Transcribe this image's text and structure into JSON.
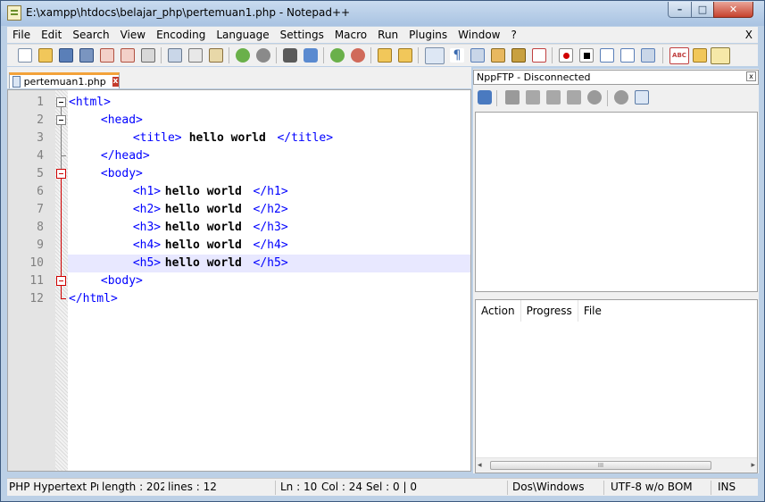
{
  "window": {
    "title": "E:\\xampp\\htdocs\\belajar_php\\pertemuan1.php - Notepad++",
    "min_glyph": "–",
    "max_glyph": "□",
    "close_glyph": "✕"
  },
  "menu": [
    "File",
    "Edit",
    "Search",
    "View",
    "Encoding",
    "Language",
    "Settings",
    "Macro",
    "Run",
    "Plugins",
    "Window",
    "?"
  ],
  "menu_close": "X",
  "toolbar_icons": [
    "new-file-icon",
    "open-file-icon",
    "save-icon",
    "save-all-icon",
    "close-icon",
    "close-all-icon",
    "print-icon",
    "cut-icon",
    "copy-icon",
    "paste-icon",
    "undo-icon",
    "redo-icon",
    "find-icon",
    "replace-icon",
    "zoom-in-icon",
    "zoom-out-icon",
    "sync-vertical-icon",
    "sync-horizontal-icon",
    "word-wrap-icon",
    "show-all-chars-icon",
    "indent-guide-icon",
    "user-language-icon",
    "doc-map-icon",
    "function-list-icon",
    "record-macro-icon",
    "stop-record-icon",
    "play-macro-icon",
    "play-multiple-icon",
    "save-macro-icon",
    "spell-check-icon",
    "folder-workspace-icon",
    "nppftp-toggle-icon"
  ],
  "tab": {
    "label": "pertemuan1.php",
    "close_glyph": "x"
  },
  "editor": {
    "current_line": 10,
    "lines": [
      {
        "num": "1",
        "indent": 0,
        "tag1": "<html>",
        "text": "",
        "tag2": ""
      },
      {
        "num": "2",
        "indent": 1,
        "tag1": "<head>",
        "text": "",
        "tag2": ""
      },
      {
        "num": "3",
        "indent": 2,
        "tag1": "<title>",
        "text": "hello world",
        "tag2": "</title>"
      },
      {
        "num": "4",
        "indent": 1,
        "tag1": "</head>",
        "text": "",
        "tag2": ""
      },
      {
        "num": "5",
        "indent": 1,
        "tag1": "<body>",
        "text": "",
        "tag2": ""
      },
      {
        "num": "6",
        "indent": 2,
        "tag1": "<h1>",
        "text": "hello world",
        "tag2": "</h1>"
      },
      {
        "num": "7",
        "indent": 2,
        "tag1": "<h2>",
        "text": "hello world",
        "tag2": "</h2>"
      },
      {
        "num": "8",
        "indent": 2,
        "tag1": "<h3>",
        "text": "hello world",
        "tag2": "</h3>"
      },
      {
        "num": "9",
        "indent": 2,
        "tag1": "<h4>",
        "text": "hello world",
        "tag2": "</h4>"
      },
      {
        "num": "10",
        "indent": 2,
        "tag1": "<h5>",
        "text": "hello world",
        "tag2": "</h5>"
      },
      {
        "num": "11",
        "indent": 1,
        "tag1": "<body>",
        "text": "",
        "tag2": ""
      },
      {
        "num": "12",
        "indent": 0,
        "tag1": "</html>",
        "text": "",
        "tag2": ""
      }
    ]
  },
  "nppftp": {
    "title": "NppFTP - Disconnected",
    "close_glyph": "x",
    "toolbar_icons": [
      "connect-icon",
      "disconnect-icon",
      "download-icon",
      "upload-icon",
      "refresh-icon",
      "abort-icon",
      "settings-icon",
      "message-window-icon"
    ],
    "queue_columns": [
      "Action",
      "Progress",
      "File"
    ],
    "scroll_left": "◂",
    "scroll_right": "▸",
    "scroll_grip": "III"
  },
  "status": {
    "language": "PHP Hypertext Prej",
    "length": "length : 202",
    "lines": "lines : 12",
    "ln": "Ln : 10",
    "col": "Col : 24",
    "sel": "Sel : 0 | 0",
    "eol": "Dos\\Windows",
    "encoding": "UTF-8 w/o BOM",
    "mode": "INS"
  },
  "colors": {
    "tag": "#0000ff",
    "text": "#000000",
    "current_line": "#e8e8ff",
    "fold_active": "#d00000",
    "tab_accent": "#f3a23a"
  }
}
